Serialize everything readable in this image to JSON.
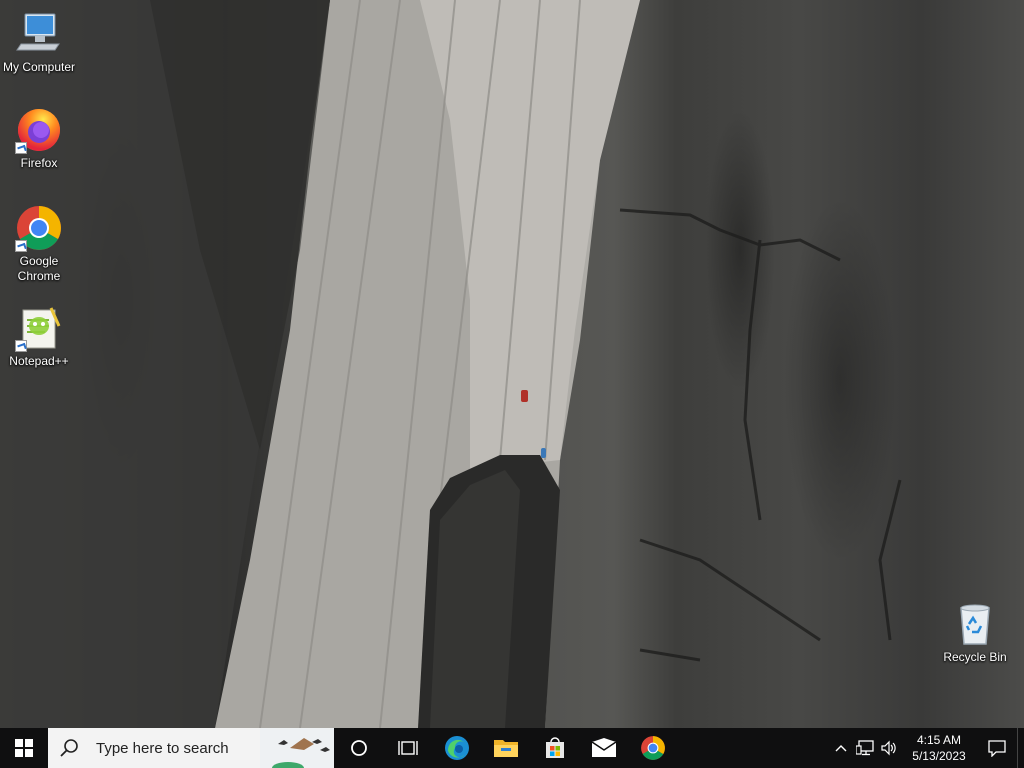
{
  "desktop": {
    "icons": [
      {
        "label": "My Computer",
        "icon": "computer-icon"
      },
      {
        "label": "Firefox",
        "icon": "firefox-icon"
      },
      {
        "label": "Google Chrome",
        "icon": "chrome-icon"
      },
      {
        "label": "Notepad++",
        "icon": "notepad-plus-plus-icon"
      },
      {
        "label": "Recycle Bin",
        "icon": "recycle-bin-icon"
      }
    ]
  },
  "taskbar": {
    "start_icon": "windows-logo-icon",
    "search": {
      "placeholder": "Type here to search"
    },
    "pinned": [
      {
        "name": "Cortana",
        "icon": "cortana-circle-icon"
      },
      {
        "name": "Task View",
        "icon": "task-view-icon"
      },
      {
        "name": "Microsoft Edge",
        "icon": "edge-icon"
      },
      {
        "name": "File Explorer",
        "icon": "file-explorer-icon"
      },
      {
        "name": "Microsoft Store",
        "icon": "store-icon"
      },
      {
        "name": "Mail",
        "icon": "mail-icon"
      },
      {
        "name": "Google Chrome",
        "icon": "chrome-icon"
      }
    ],
    "tray": {
      "icons": [
        "chevron-up-icon",
        "network-icon",
        "volume-icon"
      ],
      "time": "4:15 AM",
      "date": "5/13/2023"
    }
  },
  "colors": {
    "taskbar": "#0f0f10",
    "accent": "#0078d7"
  }
}
